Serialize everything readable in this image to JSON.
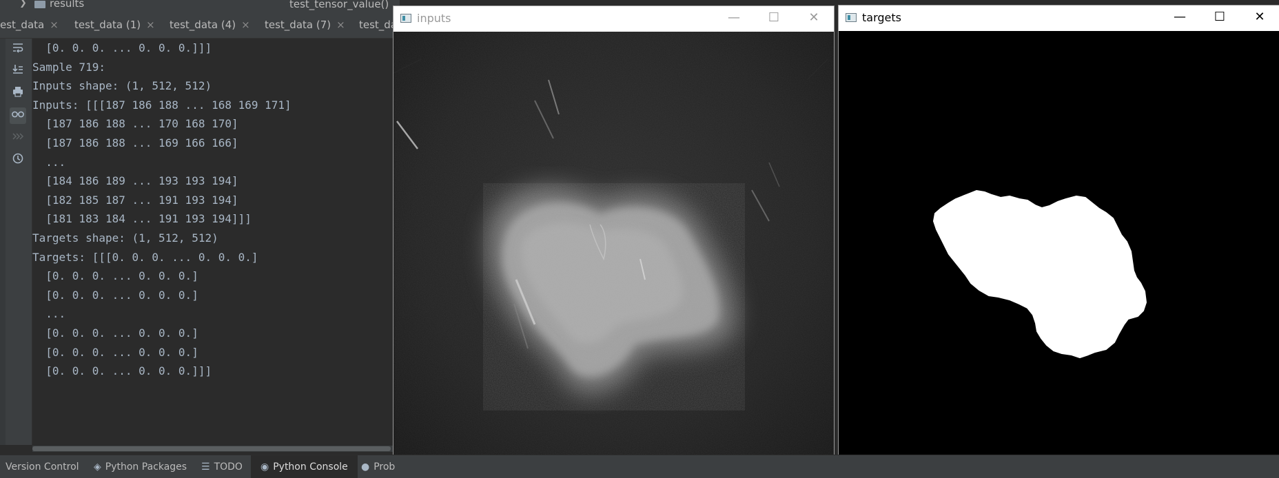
{
  "ide": {
    "tree": {
      "folder_label": "results",
      "function_label": "test_tensor_value()"
    },
    "tabs": [
      {
        "label": "est_data"
      },
      {
        "label": "test_data (1)"
      },
      {
        "label": "test_data (4)"
      },
      {
        "label": "test_data (7)"
      },
      {
        "label": "test_da"
      }
    ],
    "tab_close_glyph": "×",
    "gutter_icons": [
      "soft-wrap-icon",
      "scroll-to-end-icon",
      "print-icon",
      "glasses-icon",
      "rerun-icon",
      "history-icon"
    ],
    "console_lines": [
      "  [0. 0. 0. ... 0. 0. 0.]]]",
      "Sample 719:",
      "Inputs shape: (1, 512, 512)",
      "Inputs: [[[187 186 188 ... 168 169 171]",
      "  [187 186 188 ... 170 168 170]",
      "  [187 186 188 ... 169 166 166]",
      "  ...",
      "  [184 186 189 ... 193 193 194]",
      "  [182 185 187 ... 191 193 194]",
      "  [181 183 184 ... 191 193 194]]]",
      "Targets shape: (1, 512, 512)",
      "Targets: [[[0. 0. 0. ... 0. 0. 0.]",
      "  [0. 0. 0. ... 0. 0. 0.]",
      "  [0. 0. 0. ... 0. 0. 0.]",
      "  ...",
      "  [0. 0. 0. ... 0. 0. 0.]",
      "  [0. 0. 0. ... 0. 0. 0.]",
      "  [0. 0. 0. ... 0. 0. 0.]]]"
    ],
    "status_bar": {
      "version_control": "Version Control",
      "python_packages": "Python Packages",
      "todo": "TODO",
      "python_console": "Python Console",
      "problems": "Prob"
    }
  },
  "windows": {
    "inputs": {
      "title": "inputs"
    },
    "targets": {
      "title": "targets"
    }
  },
  "colors": {
    "ide_bg": "#2b2b2b",
    "ide_panel": "#3c3f41",
    "console_text": "#a9b7c6",
    "mask_fg": "#ffffff",
    "mask_bg": "#000000"
  }
}
